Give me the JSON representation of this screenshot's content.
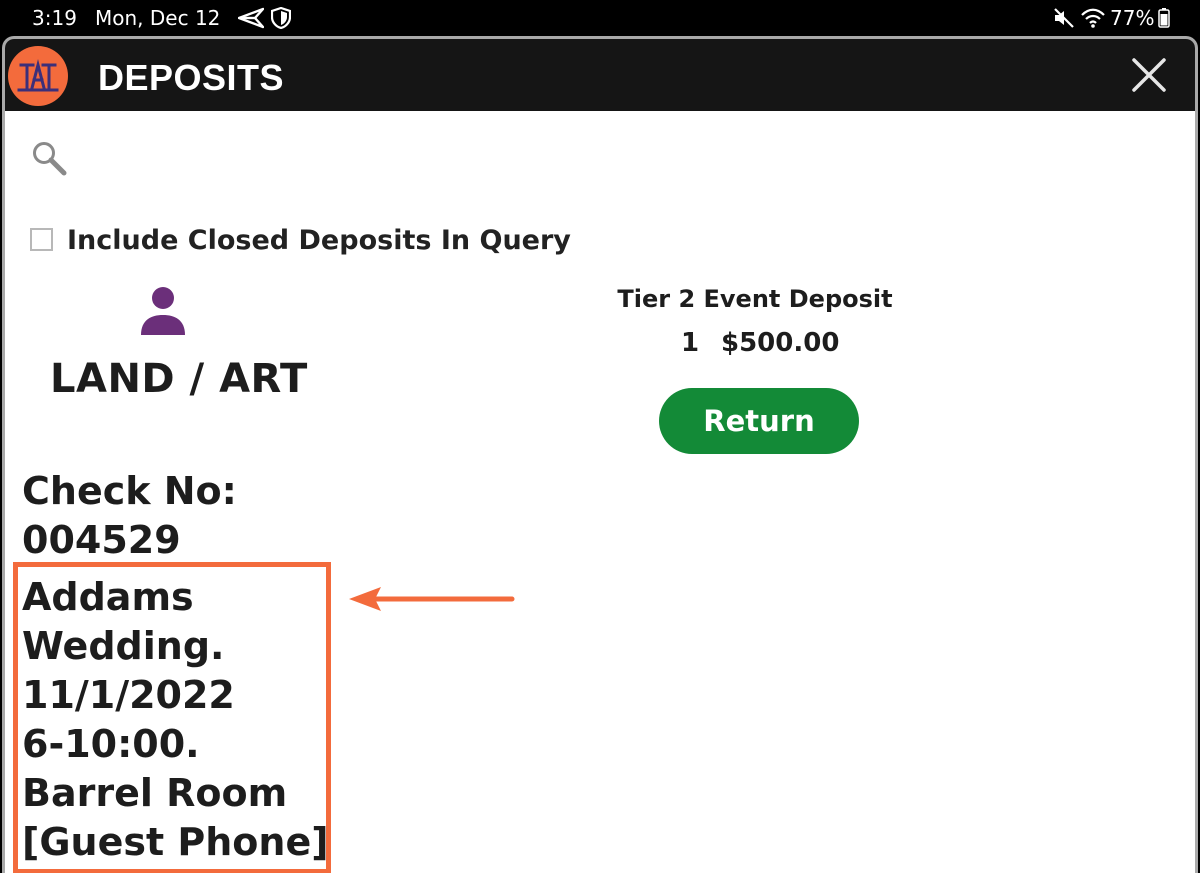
{
  "status_bar": {
    "time": "3:19",
    "date": "Mon, Dec 12",
    "battery": "77%",
    "icons": [
      "send-icon",
      "shield-icon",
      "mute-icon",
      "wifi-icon",
      "battery-icon"
    ]
  },
  "dialog": {
    "title": "DEPOSITS",
    "logo_text": "TAT",
    "close_icon": "close-icon",
    "search_icon": "search-icon"
  },
  "filter": {
    "include_closed_label": "Include Closed Deposits In Query",
    "include_closed_checked": false
  },
  "customer": {
    "icon": "person-icon",
    "name": "LAND / ART"
  },
  "deposit": {
    "name": "Tier 2 Event Deposit",
    "quantity": "1",
    "amount": "$500.00",
    "return_label": "Return"
  },
  "check": {
    "label": "Check No:",
    "number": "004529",
    "memo_lines": [
      "Addams",
      "Wedding.",
      "11/1/2022",
      "6-10:00.",
      "Barrel Room",
      "[Guest Phone]"
    ]
  },
  "colors": {
    "accent": "#f36b3c",
    "return_button": "#138a37",
    "titlebar": "#151515",
    "person_icon": "#6b2f7a"
  }
}
